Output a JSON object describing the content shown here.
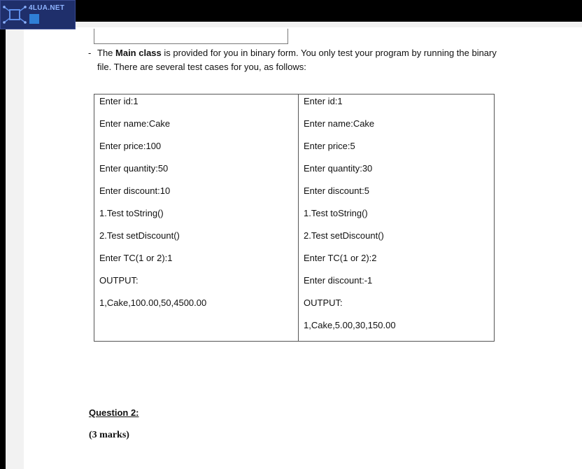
{
  "watermark": {
    "text": "4LUA.NET"
  },
  "intro": {
    "dash": "-",
    "prefix": "The ",
    "bold": "Main class",
    "suffix": " is provided for you in binary form. You only test your program by running the binary file. There are several test cases for you, as follows:"
  },
  "testcases": [
    {
      "lines": [
        "Enter id:1",
        "Enter name:Cake",
        "Enter price:100",
        "Enter quantity:50",
        "Enter discount:10",
        "1.Test toString()",
        "2.Test setDiscount()",
        "Enter TC(1 or 2):1",
        "OUTPUT:",
        "1,Cake,100.00,50,4500.00"
      ]
    },
    {
      "lines": [
        "Enter id:1",
        "Enter name:Cake",
        "Enter price:5",
        "Enter quantity:30",
        "Enter discount:5",
        "1.Test toString()",
        "2.Test setDiscount()",
        "Enter TC(1 or 2):2",
        "Enter discount:-1",
        "OUTPUT:",
        "1,Cake,5.00,30,150.00"
      ]
    }
  ],
  "question": {
    "title": "Question 2:",
    "marks": "(3 marks)"
  }
}
